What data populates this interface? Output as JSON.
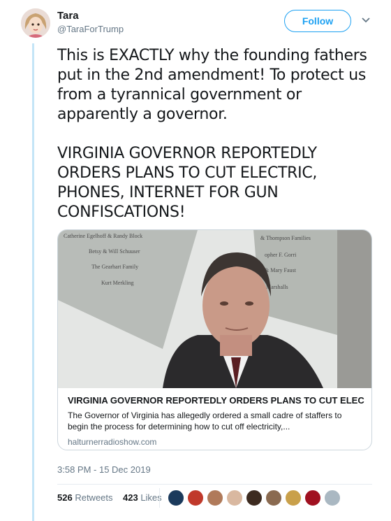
{
  "user": {
    "name": "Tara",
    "handle": "@TaraForTrump"
  },
  "follow_label": "Follow",
  "tweet": {
    "paragraph1": "This is EXACTLY why the founding fathers put in the 2nd amendment! To protect us from a tyrannical government or apparently a governor.",
    "paragraph2": "VIRGINIA GOVERNOR REPORTEDLY ORDERS PLANS TO CUT ELECTRIC, PHONES, INTERNET FOR GUN CONFISCATIONS!"
  },
  "card": {
    "title": "VIRGINIA GOVERNOR REPORTEDLY ORDERS PLANS TO CUT ELEC...",
    "description": "The Governor of Virginia has allegedly ordered a small cadre of staffers to begin the process for determining how to cut off electricity,...",
    "domain": "halturnerradioshow.com",
    "sign_left": [
      "Catherine Egelhoff & Randy Block",
      "Betsy & Will Schuuser",
      "The Gearhart Family",
      "Kurt Merkling"
    ],
    "sign_right": [
      "& Thompson Families",
      "opher F. Gorri",
      "& Mary Faust",
      "Marshalls"
    ]
  },
  "timestamp": "3:58 PM - 15 Dec 2019",
  "stats": {
    "retweets_count": "526",
    "retweets_label": "Retweets",
    "likes_count": "423",
    "likes_label": "Likes"
  },
  "liker_colors": [
    "#1b3a5c",
    "#c0392b",
    "#b07a5a",
    "#d9b8a0",
    "#3d2b20",
    "#8a6a50",
    "#c9a04a",
    "#a01020",
    "#aab8c2"
  ]
}
